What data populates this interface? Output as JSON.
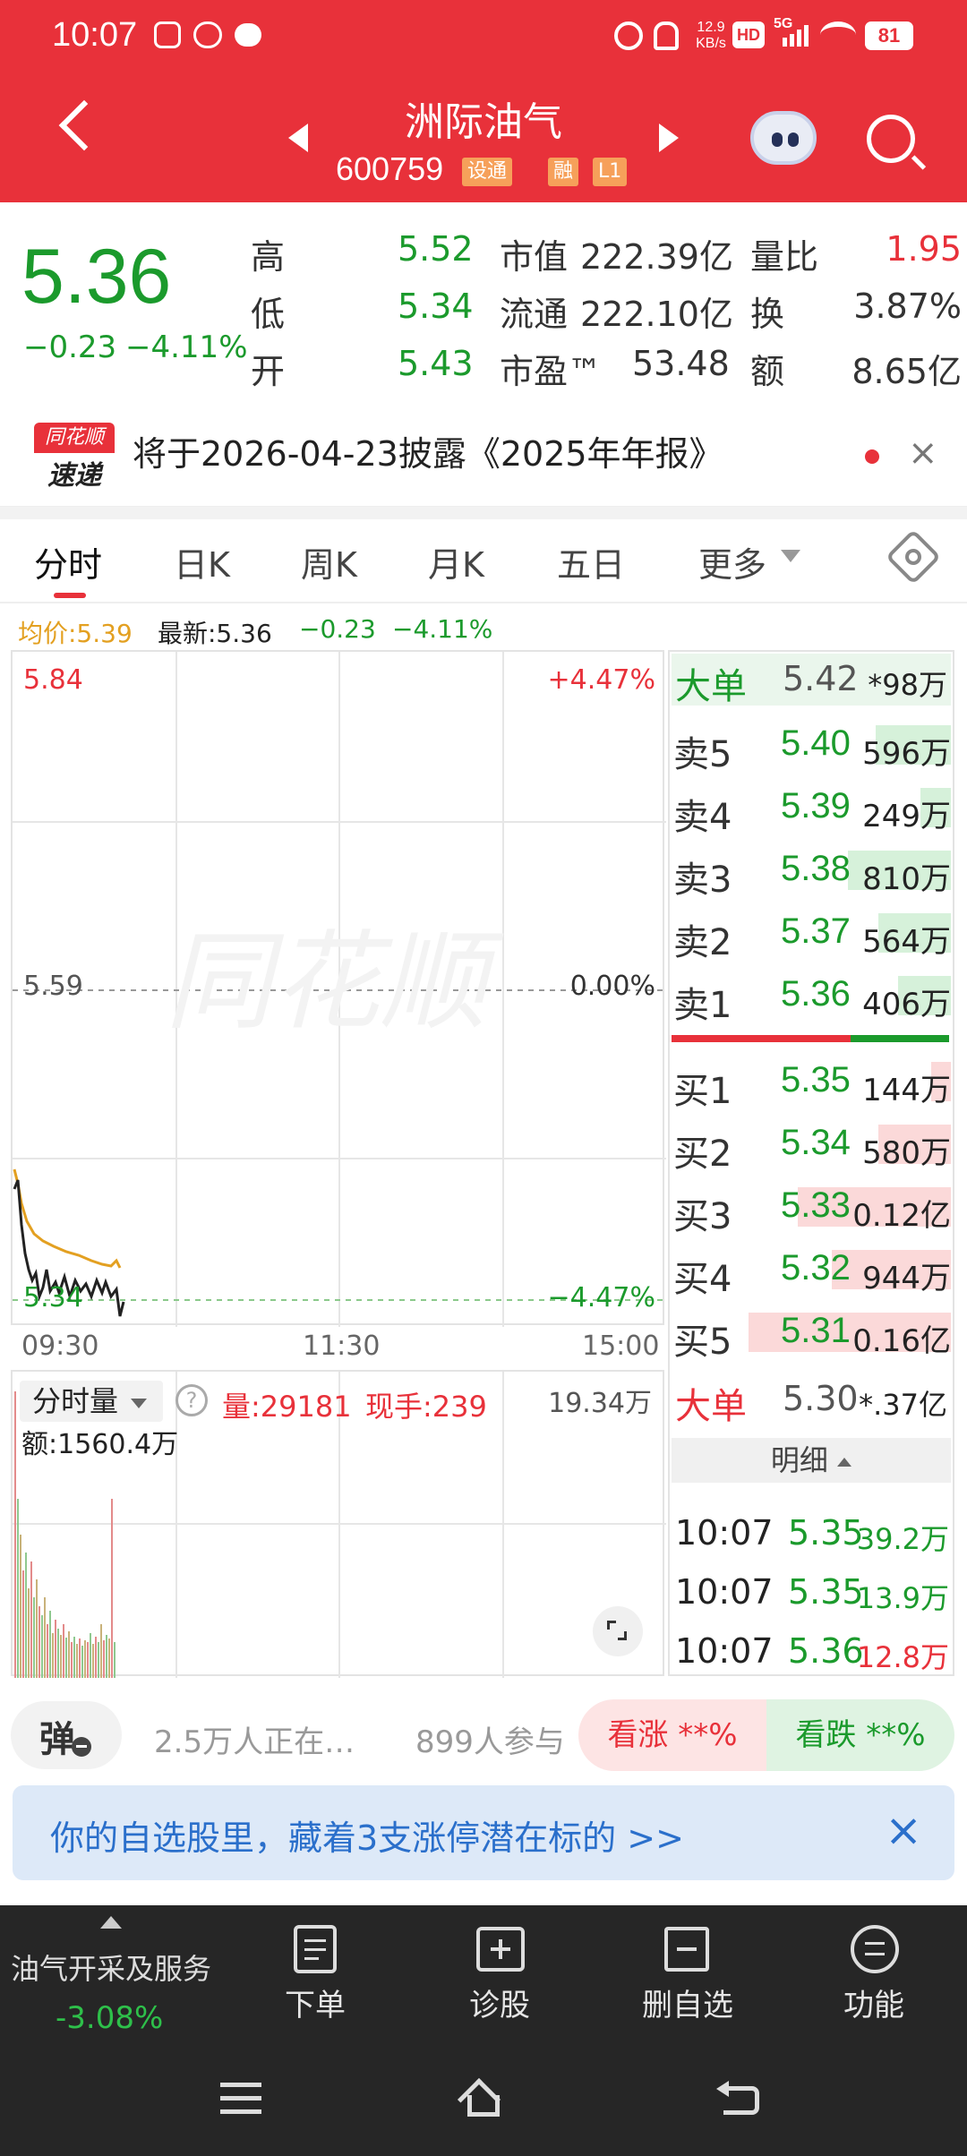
{
  "status_bar": {
    "time": "10:07",
    "speed_value": "12.9",
    "speed_unit": "KB/s",
    "hd": "HD",
    "network": "5G",
    "battery": "81"
  },
  "header": {
    "stock_name": "洲际油气",
    "stock_code": "600759",
    "tag_hgt": "设通",
    "tag_margin": "融",
    "tag_level": "L1"
  },
  "quote": {
    "price": "5.36",
    "change": "−0.23",
    "change_pct": "−4.11%",
    "high_label": "高",
    "high": "5.52",
    "low_label": "低",
    "low": "5.34",
    "open_label": "开",
    "open": "5.43",
    "mcap_label": "市值",
    "mcap": "222.39亿",
    "float_label": "流通",
    "float": "222.10亿",
    "pe_label": "市盈™",
    "pe": "53.48",
    "vr_label": "量比",
    "vr": "1.95",
    "turnover_label": "换",
    "turnover": "3.87%",
    "amount_label": "额",
    "amount": "8.65亿"
  },
  "notice": {
    "logo_top": "同花顺",
    "logo_bottom": "速递",
    "text": "将于2026-04-23披露《2025年年报》"
  },
  "tabs": [
    {
      "label": "分时",
      "active": true
    },
    {
      "label": "日K"
    },
    {
      "label": "周K"
    },
    {
      "label": "月K"
    },
    {
      "label": "五日"
    },
    {
      "label": "更多"
    }
  ],
  "chart_info": {
    "avg": "均价:5.39",
    "latest": "最新:5.36",
    "chg": "−0.23",
    "chg_pct": "−4.11%"
  },
  "chart_labels": {
    "top_price": "5.84",
    "top_pct": "+4.47%",
    "mid_price": "5.59",
    "mid_pct": "0.00%",
    "bot_price": "5.34",
    "bot_pct": "−4.47%",
    "t_start": "09:30",
    "t_mid": "11:30",
    "t_end": "15:00",
    "watermark": "同花顺"
  },
  "volume_panel": {
    "selector": "分时量",
    "vol_label": "量:29181",
    "cur_label": "现手:239",
    "max": "19.34万",
    "amount": "额:1560.4万"
  },
  "order_book": {
    "big_sell": {
      "name": "大单",
      "price": "5.42",
      "vol": "*98万"
    },
    "asks": [
      {
        "name": "卖5",
        "price": "5.40",
        "vol": "596万",
        "bar": 0.27
      },
      {
        "name": "卖4",
        "price": "5.39",
        "vol": "249万",
        "bar": 0.11
      },
      {
        "name": "卖3",
        "price": "5.38",
        "vol": "810万",
        "bar": 0.37
      },
      {
        "name": "卖2",
        "price": "5.37",
        "vol": "564万",
        "bar": 0.26
      },
      {
        "name": "卖1",
        "price": "5.36",
        "vol": "406万",
        "bar": 0.19
      }
    ],
    "bids": [
      {
        "name": "买1",
        "price": "5.35",
        "vol": "144万",
        "bar": 0.07
      },
      {
        "name": "买2",
        "price": "5.34",
        "vol": "580万",
        "bar": 0.26
      },
      {
        "name": "买3",
        "price": "5.33",
        "vol": "0.12亿",
        "bar": 0.55
      },
      {
        "name": "买4",
        "price": "5.32",
        "vol": "944万",
        "bar": 0.43
      },
      {
        "name": "买5",
        "price": "5.31",
        "vol": "0.16亿",
        "bar": 0.73
      }
    ],
    "big_buy": {
      "name": "大单",
      "price": "5.30",
      "vol": "*.37亿"
    },
    "detail_label": "明细",
    "ticks": [
      {
        "time": "10:07",
        "price": "5.35",
        "vol": "39.2万"
      },
      {
        "time": "10:07",
        "price": "5.35",
        "vol": "13.9万"
      },
      {
        "time": "10:07",
        "price": "5.36",
        "vol": "12.8万"
      }
    ]
  },
  "community": {
    "danmu": "弹",
    "online": "2.5万人正在…",
    "participants": "899人参与",
    "bull": "看涨 **%",
    "bear": "看跌 **%"
  },
  "banner": {
    "text": "你的自选股里，藏着3支涨停潜在标的 >>"
  },
  "bottom_nav": {
    "sector": "油气开采及服务",
    "sector_pct": "-3.08%",
    "items": [
      {
        "label": "下单"
      },
      {
        "label": "诊股"
      },
      {
        "label": "删自选"
      },
      {
        "label": "功能"
      }
    ]
  },
  "colors": {
    "brand_red": "#e8313a",
    "down_green": "#1b9a2c",
    "avg_line": "#e3a021"
  }
}
